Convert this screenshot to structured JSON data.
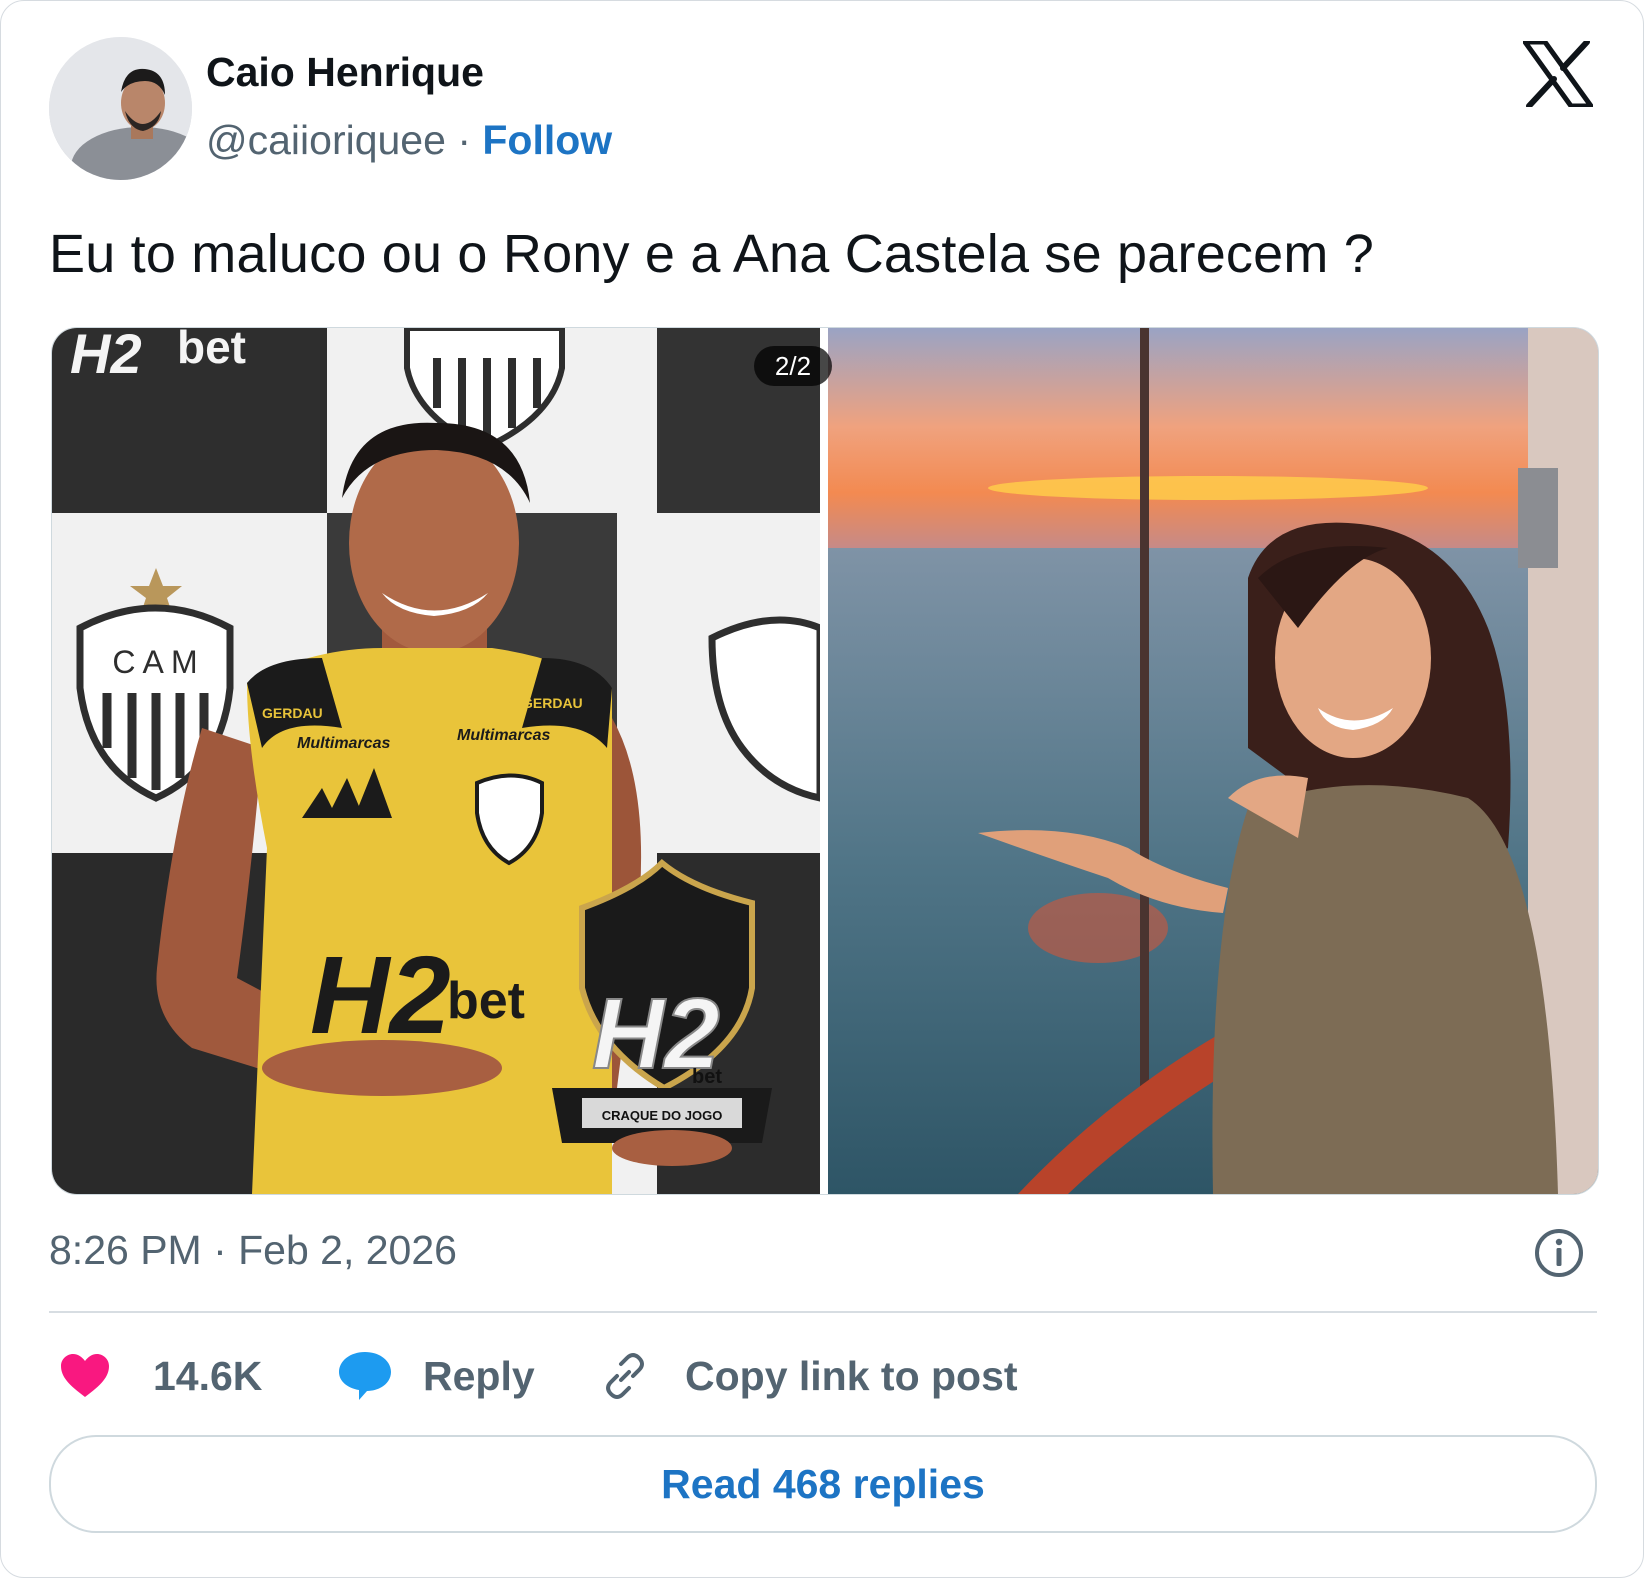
{
  "author": {
    "display_name": "Caio Henrique",
    "handle": "@caiioriquee",
    "separator": "·",
    "follow_label": "Follow"
  },
  "tweet": {
    "text": "Eu to maluco ou o Rony e a Ana Castela se parecem ?",
    "timestamp": "8:26 PM · Feb 2, 2026"
  },
  "media": {
    "counter": "2/2",
    "left_photo": {
      "backdrop_brand": "bet",
      "club_badge": "C A M",
      "jersey_sponsor_1": "GERDAU",
      "jersey_sponsor_2": "Multimarcas",
      "jersey_main": "H2",
      "jersey_main_suffix": "bet",
      "trophy_brand": "H2",
      "trophy_brand_suffix": "bet",
      "trophy_plate": "CRAQUE DO JOGO"
    }
  },
  "actions": {
    "likes": "14.6K",
    "reply_label": "Reply",
    "copy_label": "Copy link to post"
  },
  "read_replies_label": "Read 468 replies",
  "colors": {
    "accent_blue": "#1d74c4",
    "like_pink": "#f91880",
    "reply_blue": "#1d9bf0",
    "secondary_text": "#536471"
  },
  "icons": [
    "x-logo-icon",
    "info-icon",
    "heart-icon",
    "speech-bubble-icon",
    "link-icon"
  ]
}
